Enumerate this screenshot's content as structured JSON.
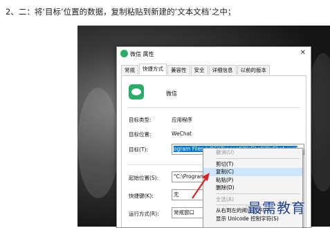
{
  "instruction": "2、二：将‘目标’位置的数据，复制粘贴到新建的‘文本文档’之中；",
  "dialog": {
    "title": "微信 属性",
    "close_label": "✕",
    "tabs": [
      "常规",
      "快捷方式",
      "兼容性",
      "安全",
      "详细信息",
      "以前的版本"
    ],
    "active_tab": "快捷方式",
    "app_name": "微信",
    "rows": {
      "target_type_label": "目标类型:",
      "target_type_value": "应用程序",
      "target_location_label": "目标位置:",
      "target_location_value": "WeChat",
      "target_label": "目标(T):",
      "target_value": "ogram Files (x86)\\Tencent\\WeChat\\WeChat.exe\"",
      "start_in_label": "起始位置(S):",
      "start_in_value": "\"C:\\Program",
      "shortcut_key_label": "快捷键(K):",
      "shortcut_key_value": "无",
      "run_label": "运行方式(R):",
      "run_value": "常规窗口"
    }
  },
  "context_menu": {
    "items": [
      {
        "label": "撤消(U)",
        "disabled": true
      },
      {
        "sep": true
      },
      {
        "label": "剪切(T)"
      },
      {
        "label": "复制(C)",
        "highlight": true
      },
      {
        "label": "粘贴(P)"
      },
      {
        "label": "删除(D)"
      },
      {
        "sep": true
      },
      {
        "label": "全选(A)",
        "disabled": true
      },
      {
        "sep": true
      },
      {
        "label": "从右到左的阅读顺序(R)"
      },
      {
        "label": "显示 Unicode 控制字符(S)"
      }
    ]
  },
  "watermark": "最需教育",
  "colors": {
    "selection": "#0078d7",
    "arrow": "#e02020",
    "watermark": "#1c3e9c",
    "wechat_green": "#2aae67"
  }
}
